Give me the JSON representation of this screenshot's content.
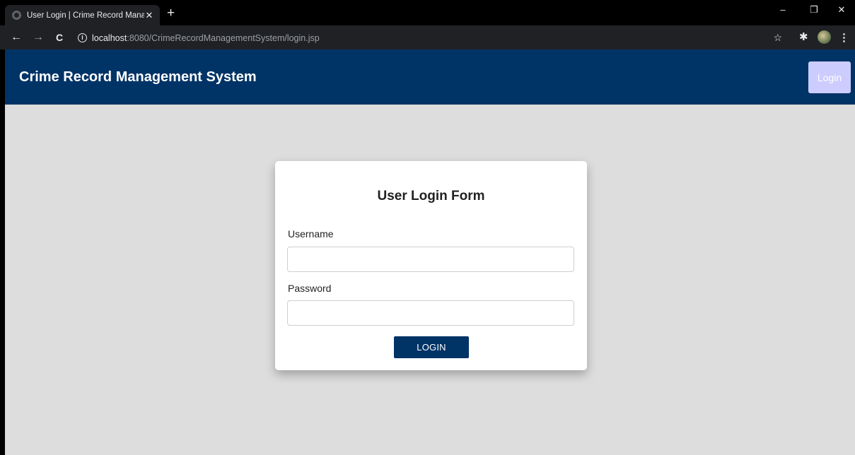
{
  "browser": {
    "tab_title": "User Login | Crime Record Manag",
    "tab_close": "✕",
    "new_tab": "+",
    "window_controls": {
      "minimize": "–",
      "restore": "❐",
      "close": "✕"
    },
    "nav": {
      "back": "←",
      "forward": "→",
      "reload": "C"
    },
    "url_host": "localhost",
    "url_rest": ":8080/CrimeRecordManagementSystem/login.jsp",
    "info_icon": "i",
    "bookmark_icon": "☆",
    "extensions_icon": "✱",
    "menu_icon": "⋮"
  },
  "header": {
    "title": "Crime Record Management System",
    "login_link": "Login"
  },
  "form": {
    "title": "User Login Form",
    "username_label": "Username",
    "username_value": "",
    "password_label": "Password",
    "password_value": "",
    "submit_label": "LOGIN"
  },
  "colors": {
    "header_bg": "#003366",
    "page_bg": "#dddddd",
    "button_bg": "#003366",
    "login_link_bg": "#ccccff"
  }
}
